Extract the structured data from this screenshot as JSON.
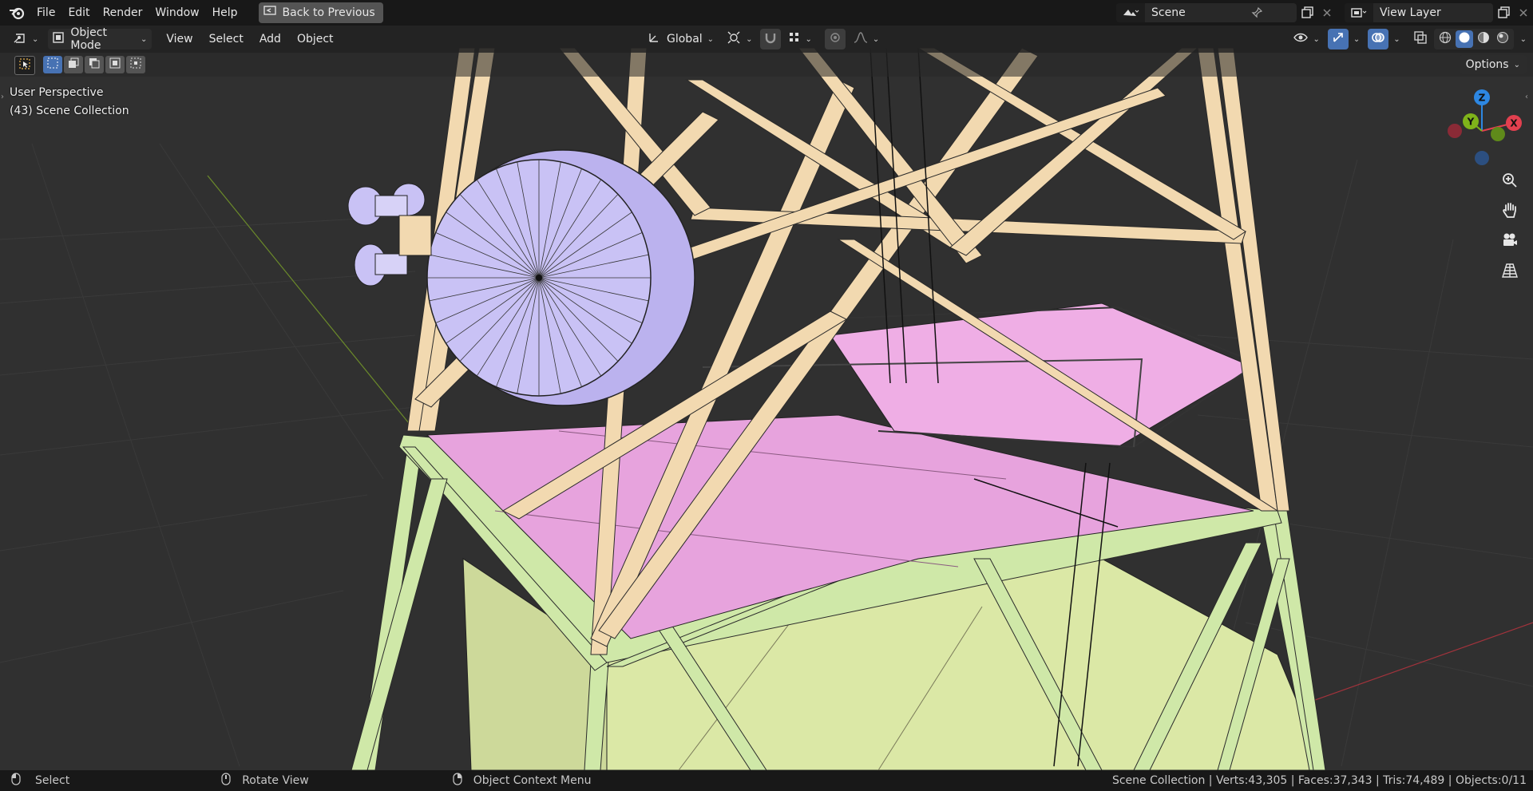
{
  "topbar": {
    "menus": [
      "File",
      "Edit",
      "Render",
      "Window",
      "Help"
    ],
    "back_button": "Back to Previous",
    "scene_name": "Scene",
    "view_layer": "View Layer"
  },
  "viewport_header": {
    "mode": "Object Mode",
    "menus": [
      "View",
      "Select",
      "Add",
      "Object"
    ],
    "transform_orientation": "Global"
  },
  "tool_row": {
    "options_label": "Options"
  },
  "overlay": {
    "perspective": "User Perspective",
    "collection": "(43) Scene Collection"
  },
  "gizmo": {
    "axis_z": "Z",
    "axis_y": "Y",
    "axis_x": "X",
    "colors": {
      "x": "#e2404f",
      "y": "#7fb31a",
      "z": "#2d87e2"
    }
  },
  "colors": {
    "pink_surface": "#e7a3dd",
    "pale_green": "#dbe8a6",
    "cream_beam": "#f2d9b0",
    "dish": "#c9c2f5",
    "active_blue": "#4772b3"
  },
  "statusbar": {
    "select": "Select",
    "rotate": "Rotate View",
    "context_menu": "Object Context Menu",
    "stats": "Scene Collection | Verts:43,305 | Faces:37,343 | Tris:74,489 | Objects:0/11"
  }
}
